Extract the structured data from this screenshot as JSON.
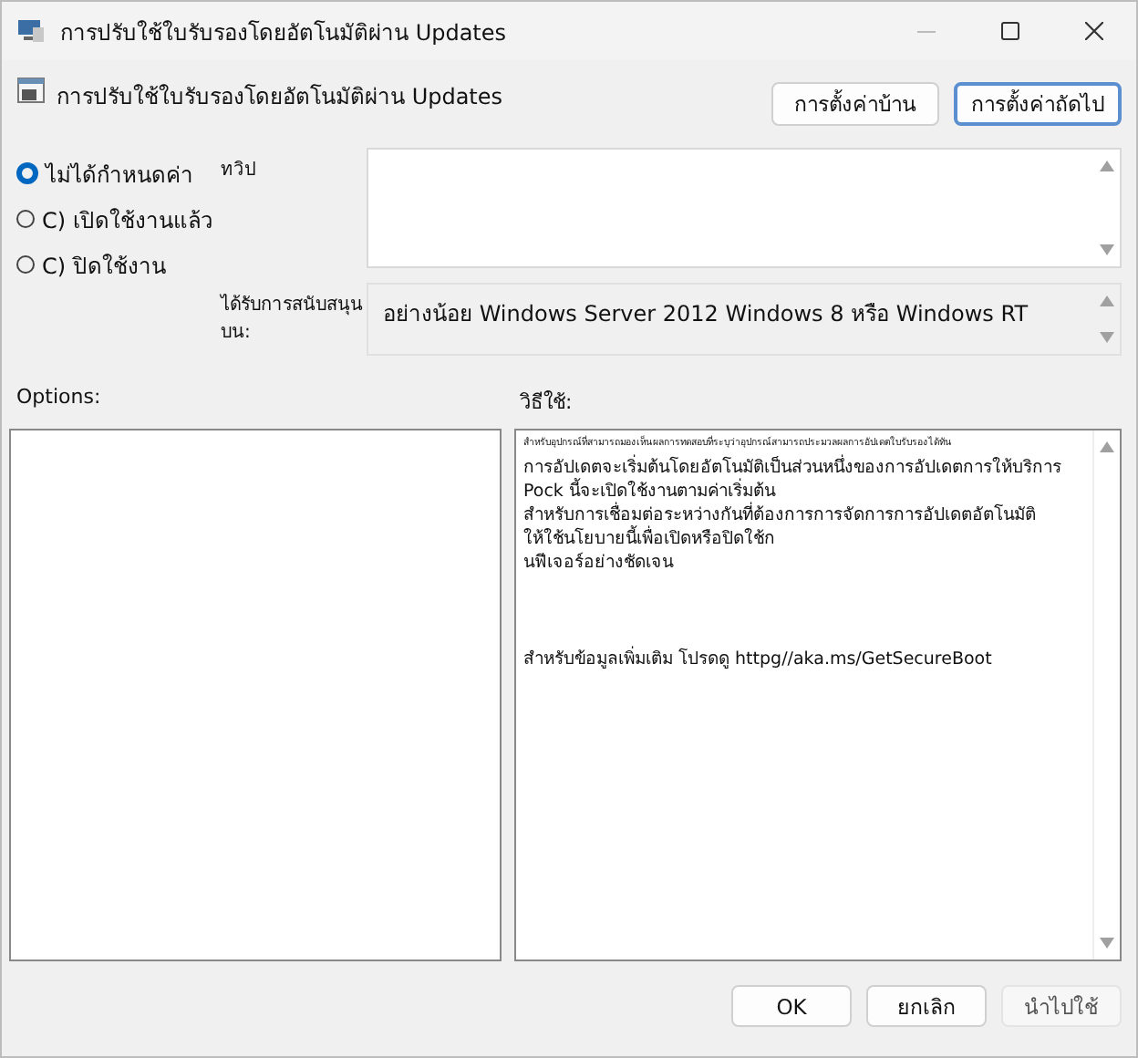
{
  "window": {
    "title": "การปรับใช้ใบรับรองโดยอัตโนมัติผ่าน Updates"
  },
  "header": {
    "title": "การปรับใช้ใบรับรองโดยอัตโนมัติผ่าน Updates",
    "buttons": [
      {
        "label": "การตั้งค่าบ้าน",
        "default": false
      },
      {
        "label": "การตั้งค่าถัดไป",
        "default": true
      }
    ]
  },
  "radios": [
    {
      "label": "ไม่ได้กำหนดค่า",
      "selected": true
    },
    {
      "label": "C) เปิดใช้งานแล้ว",
      "selected": false
    },
    {
      "label": "C) ปิดใช้งาน",
      "selected": false
    }
  ],
  "comment": {
    "label": "ทวิป"
  },
  "supported": {
    "label": "ได้รับการสนับสนุนบน:",
    "value": "อย่างน้อย Windows Server 2012 Windows 8 หรือ Windows RT"
  },
  "options": {
    "label": "Options:"
  },
  "help": {
    "label": "วิธีใช้:",
    "lines": [
      {
        "kind": "small",
        "text": "สำหรับอุปกรณ์ที่สามารถมองเห็นผลการทดสอบที่ระบุว่าอุปกรณ์สามารถประมวลผลการอัปเดตใบรับรองได้ทัน"
      },
      {
        "kind": "line",
        "text": "การอัปเดตจะเริ่มต้นโดยอัตโนมัติเป็นส่วนหนึ่งของการอัปเดตการให้บริการ"
      },
      {
        "kind": "line",
        "text": "Pock นี้จะเปิดใช้งานตามค่าเริ่มต้น"
      },
      {
        "kind": "line",
        "text": "สำหรับการเชื่อมต่อระหว่างกันที่ต้องการการจัดการการอัปเดตอัตโนมัติ"
      },
      {
        "kind": "line",
        "text": "ให้ใช้นโยบายนี้เพื่อเปิดหรือปิดใช้ก"
      },
      {
        "kind": "line",
        "text": "นฟีเจอร์อย่างชัดเจน"
      },
      {
        "kind": "spaced",
        "text": "สำหรับข้อมูลเพิ่มเติม โปรดดู httpg//aka.ms/GetSecureBoot"
      }
    ]
  },
  "footer": {
    "buttons": [
      {
        "label": "OK",
        "disabled": false
      },
      {
        "label": "ยกเลิก",
        "disabled": false
      },
      {
        "label": "นำไปใช้",
        "disabled": true
      }
    ]
  }
}
